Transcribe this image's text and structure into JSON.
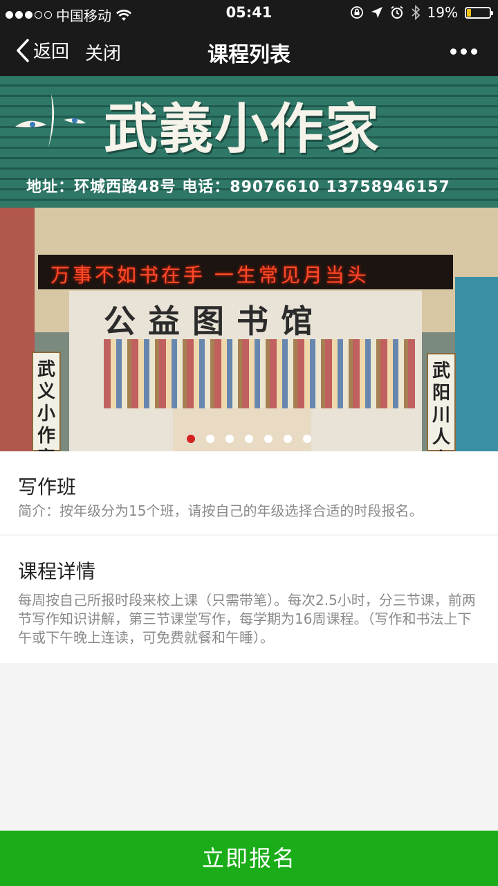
{
  "status_bar": {
    "carrier": "中国移动",
    "time": "05:41",
    "battery_percent": "19%",
    "battery_level": 0.19,
    "battery_color": "#f3c316",
    "icons": [
      "signal-dots-icon",
      "wifi-icon",
      "orientation-lock-icon",
      "location-icon",
      "alarm-icon",
      "bluetooth-icon",
      "battery-icon"
    ]
  },
  "navbar": {
    "back_label": "返回",
    "close_label": "关闭",
    "title": "课程列表",
    "more_icon": "more-dots-icon"
  },
  "banner": {
    "sign_title": "武義小作家",
    "sign_address": "地址：环城西路48号 电话：89076610   13758946157",
    "led_text": "万事不如书在手   一生常见月当头",
    "library_sign": "公益图书馆",
    "left_banner": "武义小作家",
    "right_banner": "武阳川人文",
    "slides_count": 7,
    "active_slide": 1
  },
  "course": {
    "title": "写作班",
    "summary": "简介：按年级分为15个班，请按自己的年级选择合适的时段报名。"
  },
  "details": {
    "title": "课程详情",
    "body": "每周按自己所报时段来校上课（只需带笔）。每次2.5小时，分三节课，前两节写作知识讲解，第三节课堂写作，每学期为16周课程。（写作和书法上下午或下午晚上连读，可免费就餐和午睡）。"
  },
  "cta": {
    "label": "立即报名",
    "color": "#1aad19"
  }
}
